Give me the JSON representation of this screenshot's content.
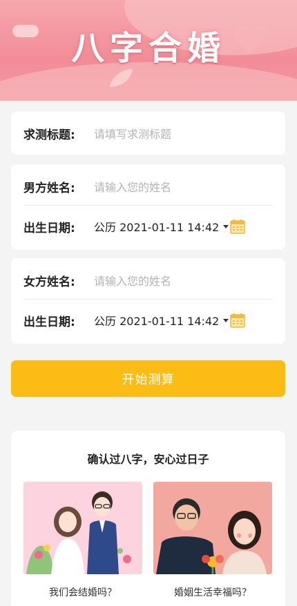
{
  "banner": {
    "title": "八字合婚"
  },
  "subject": {
    "label": "求测标题:",
    "placeholder": "请填写求测标题"
  },
  "male": {
    "name_label": "男方姓名:",
    "name_placeholder": "请输入您的姓名",
    "date_label": "出生日期:",
    "date_value": "公历 2021-01-11 14:42"
  },
  "female": {
    "name_label": "女方姓名:",
    "name_placeholder": "请输入您的姓名",
    "date_label": "出生日期:",
    "date_value": "公历 2021-01-11 14:42"
  },
  "start_button": "开始测算",
  "promo": {
    "title": "确认过八字，安心过日子",
    "items": [
      {
        "caption": "我们会结婚吗？"
      },
      {
        "caption": "婚姻生活幸福吗？"
      }
    ]
  },
  "colors": {
    "accent": "#fbbc14",
    "banner": "#f28c97",
    "calendar": "#f3b93a"
  },
  "icons": [
    "calendar-icon",
    "chevron-down-icon",
    "heart-icon",
    "cloud-icon"
  ]
}
